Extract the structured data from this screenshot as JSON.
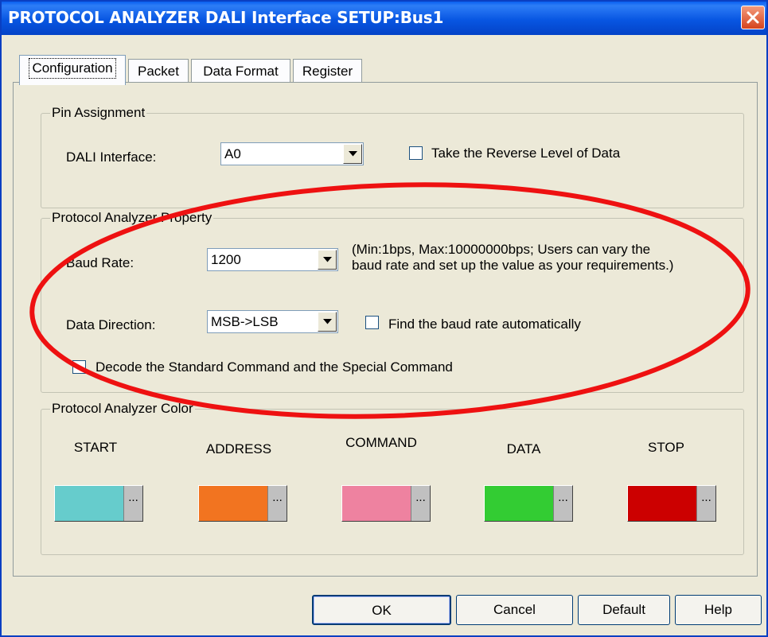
{
  "window": {
    "title": "PROTOCOL ANALYZER DALI Interface SETUP:Bus1"
  },
  "tabs": [
    {
      "label": "Configuration"
    },
    {
      "label": "Packet"
    },
    {
      "label": "Data Format"
    },
    {
      "label": "Register"
    }
  ],
  "pin_assignment": {
    "legend": "Pin Assignment",
    "dali_label": "DALI Interface:",
    "dali_value": "A0",
    "reverse_label": "Take the Reverse Level of Data"
  },
  "property": {
    "legend": "Protocol Analyzer Property",
    "baud_label": "Baud Rate:",
    "baud_value": "1200",
    "baud_note_1": "(Min:1bps, Max:10000000bps; Users can vary the",
    "baud_note_2": "baud rate and set up the value as your requirements.)",
    "direction_label": "Data Direction:",
    "direction_value": "MSB->LSB",
    "auto_label": "Find the baud rate automatically",
    "decode_label": "Decode the Standard Command and the Special Command"
  },
  "colors": {
    "legend": "Protocol Analyzer Color",
    "items": [
      {
        "label": "START",
        "color": "#66cccc"
      },
      {
        "label": "ADDRESS",
        "color": "#f27420"
      },
      {
        "label": "COMMAND",
        "color": "#ee82a0"
      },
      {
        "label": "DATA",
        "color": "#33cc33"
      },
      {
        "label": "STOP",
        "color": "#cc0000"
      }
    ],
    "picker": "..."
  },
  "buttons": {
    "ok": "OK",
    "cancel": "Cancel",
    "default": "Default",
    "help": "Help"
  },
  "annotation": {
    "color": "#ee1111"
  }
}
